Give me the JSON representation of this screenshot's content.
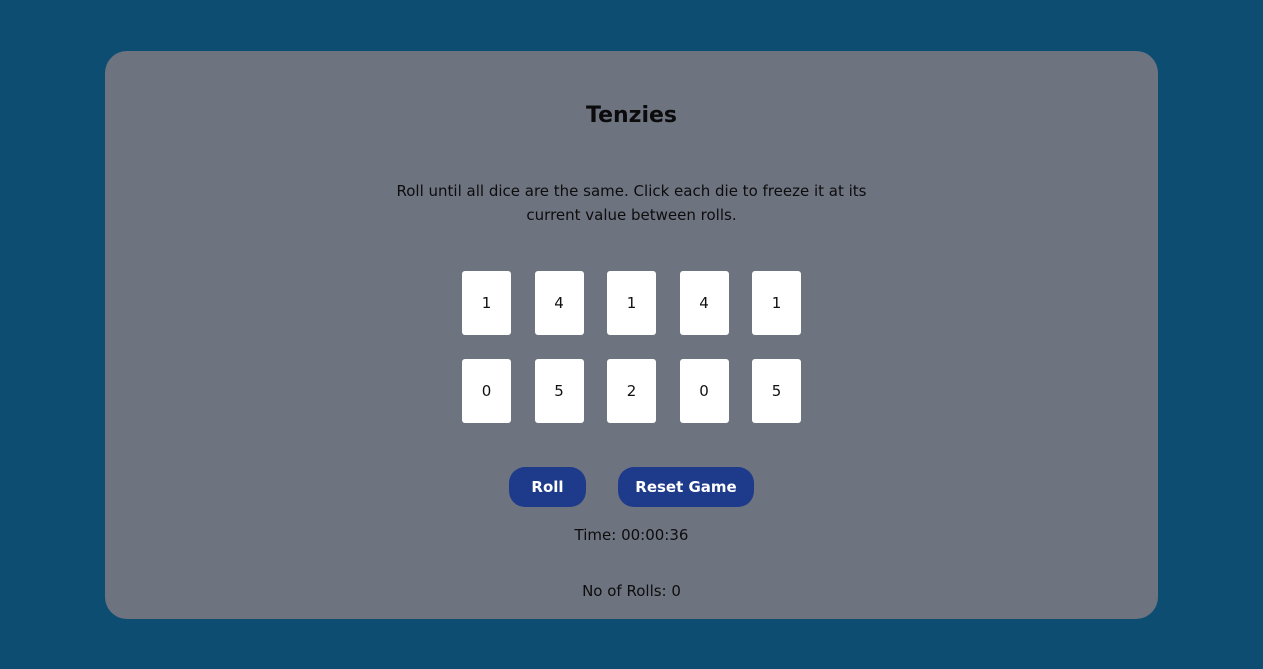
{
  "game": {
    "title": "Tenzies",
    "instructions": "Roll until all dice are the same. Click each die to freeze it at its current value between rolls."
  },
  "dice": [
    "1",
    "4",
    "1",
    "4",
    "1",
    "0",
    "5",
    "2",
    "0",
    "5"
  ],
  "buttons": {
    "roll": "Roll",
    "reset": "Reset Game"
  },
  "stats": {
    "time": "Time: 00:00:36",
    "rolls": "No of Rolls: 0"
  },
  "colors": {
    "background": "#0c4d71",
    "card": "#6e7380",
    "button": "#1e3a8a",
    "die": "#ffffff"
  }
}
